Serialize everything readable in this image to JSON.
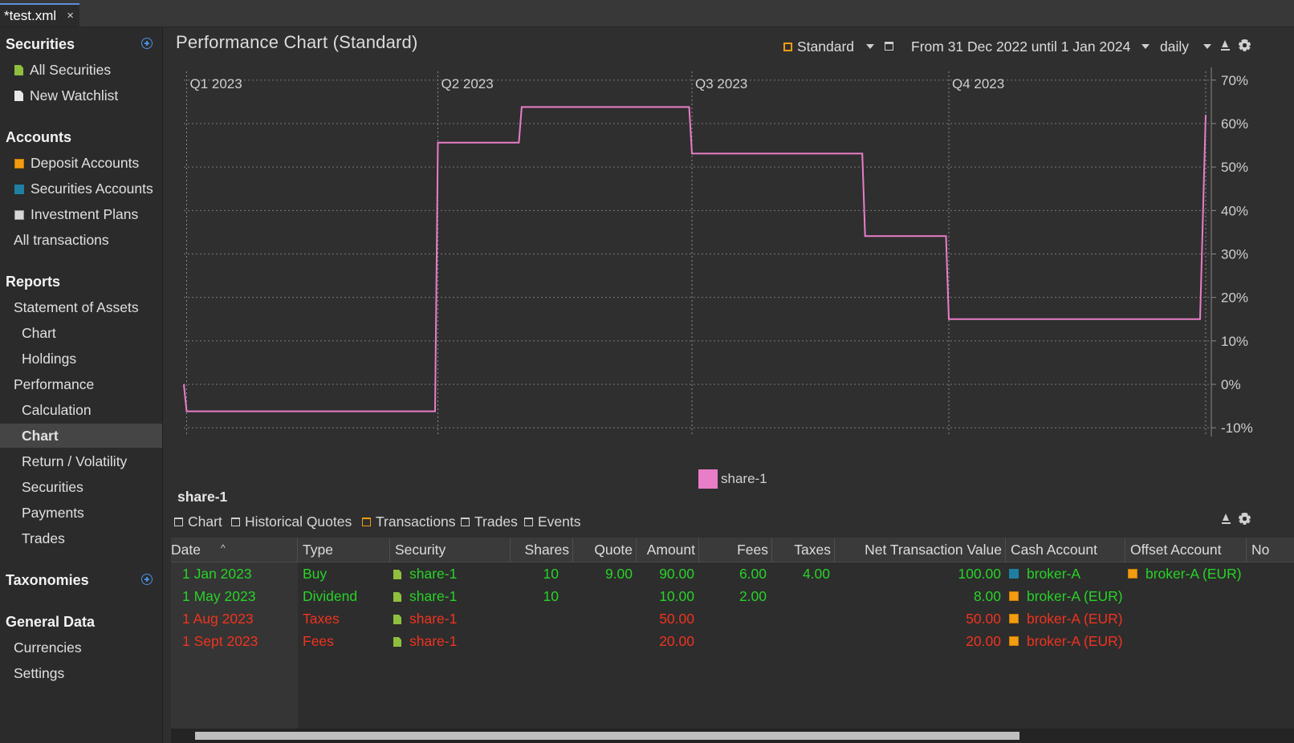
{
  "tab": {
    "title": "*test.xml",
    "close": "×"
  },
  "sidebar": {
    "securities_heading": "Securities",
    "all_securities": "All Securities",
    "new_watchlist": "New Watchlist",
    "accounts_heading": "Accounts",
    "deposit_accounts": "Deposit Accounts",
    "securities_accounts": "Securities Accounts",
    "investment_plans": "Investment Plans",
    "all_transactions": "All transactions",
    "reports_heading": "Reports",
    "statement_of_assets": "Statement of Assets",
    "soa_chart": "Chart",
    "holdings": "Holdings",
    "performance": "Performance",
    "calculation": "Calculation",
    "perf_chart": "Chart",
    "return_volatility": "Return / Volatility",
    "perf_securities": "Securities",
    "payments": "Payments",
    "trades": "Trades",
    "taxonomies_heading": "Taxonomies",
    "general_data_heading": "General Data",
    "currencies": "Currencies",
    "settings": "Settings"
  },
  "header": {
    "title": "Performance Chart (Standard)",
    "view_label": "Standard",
    "period_label": "From 31 Dec 2022 until 1 Jan 2024",
    "interval_label": "daily"
  },
  "chart_data": {
    "type": "line",
    "title": "",
    "xlabel": "",
    "ylabel": "",
    "quarters": [
      "Q1 2023",
      "Q2 2023",
      "Q3 2023",
      "Q4 2023"
    ],
    "quarter_dates": [
      "2023-01-01",
      "2023-04-01",
      "2023-07-01",
      "2023-10-01"
    ],
    "xlim": [
      "2022-12-31",
      "2024-01-01"
    ],
    "ylim": [
      -12,
      72
    ],
    "yticks": [
      -10,
      0,
      10,
      20,
      30,
      40,
      50,
      60,
      70
    ],
    "ytick_labels": [
      "-10%",
      "0%",
      "10%",
      "20%",
      "30%",
      "40%",
      "50%",
      "60%",
      "70%"
    ],
    "grid": true,
    "legend_position": "bottom-center",
    "series": [
      {
        "name": "share-1",
        "color": "#e87dc8",
        "points": [
          [
            "2022-12-31",
            0
          ],
          [
            "2023-01-01",
            -6.2
          ],
          [
            "2023-03-31",
            -6.2
          ],
          [
            "2023-04-01",
            55.6
          ],
          [
            "2023-04-30",
            55.6
          ],
          [
            "2023-05-01",
            63.8
          ],
          [
            "2023-06-30",
            63.8
          ],
          [
            "2023-07-01",
            53.1
          ],
          [
            "2023-08-31",
            53.1
          ],
          [
            "2023-09-01",
            34.1
          ],
          [
            "2023-09-30",
            34.1
          ],
          [
            "2023-10-01",
            15.0
          ],
          [
            "2023-12-30",
            15.0
          ],
          [
            "2024-01-01",
            62.0
          ]
        ]
      }
    ]
  },
  "detail": {
    "title": "share-1",
    "tabs": [
      "Chart",
      "Historical Quotes",
      "Transactions",
      "Trades",
      "Events"
    ]
  },
  "table": {
    "columns": [
      "Date",
      "Type",
      "Security",
      "Shares",
      "Quote",
      "Amount",
      "Fees",
      "Taxes",
      "Net Transaction Value",
      "Cash Account",
      "Offset Account",
      "No"
    ],
    "sort_indicator": "^",
    "rows": [
      {
        "date": "1 Jan 2023",
        "type": "Buy",
        "security": "share-1",
        "shares": "10",
        "quote": "9.00",
        "amount": "90.00",
        "fees": "6.00",
        "taxes": "4.00",
        "net": "100.00",
        "cash": "broker-A",
        "offset": "broker-A (EUR)",
        "color": "#27d327"
      },
      {
        "date": "1 May 2023",
        "type": "Dividend",
        "security": "share-1",
        "shares": "10",
        "quote": "",
        "amount": "10.00",
        "fees": "2.00",
        "taxes": "",
        "net": "8.00",
        "cash": "broker-A (EUR)",
        "offset": "",
        "color": "#27d327"
      },
      {
        "date": "1 Aug 2023",
        "type": "Taxes",
        "security": "share-1",
        "shares": "",
        "quote": "",
        "amount": "50.00",
        "fees": "",
        "taxes": "",
        "net": "50.00",
        "cash": "broker-A (EUR)",
        "offset": "",
        "color": "#f0331f"
      },
      {
        "date": "1 Sept 2023",
        "type": "Fees",
        "security": "share-1",
        "shares": "",
        "quote": "",
        "amount": "20.00",
        "fees": "",
        "taxes": "",
        "net": "20.00",
        "cash": "broker-A (EUR)",
        "offset": "",
        "color": "#f0331f"
      }
    ]
  }
}
